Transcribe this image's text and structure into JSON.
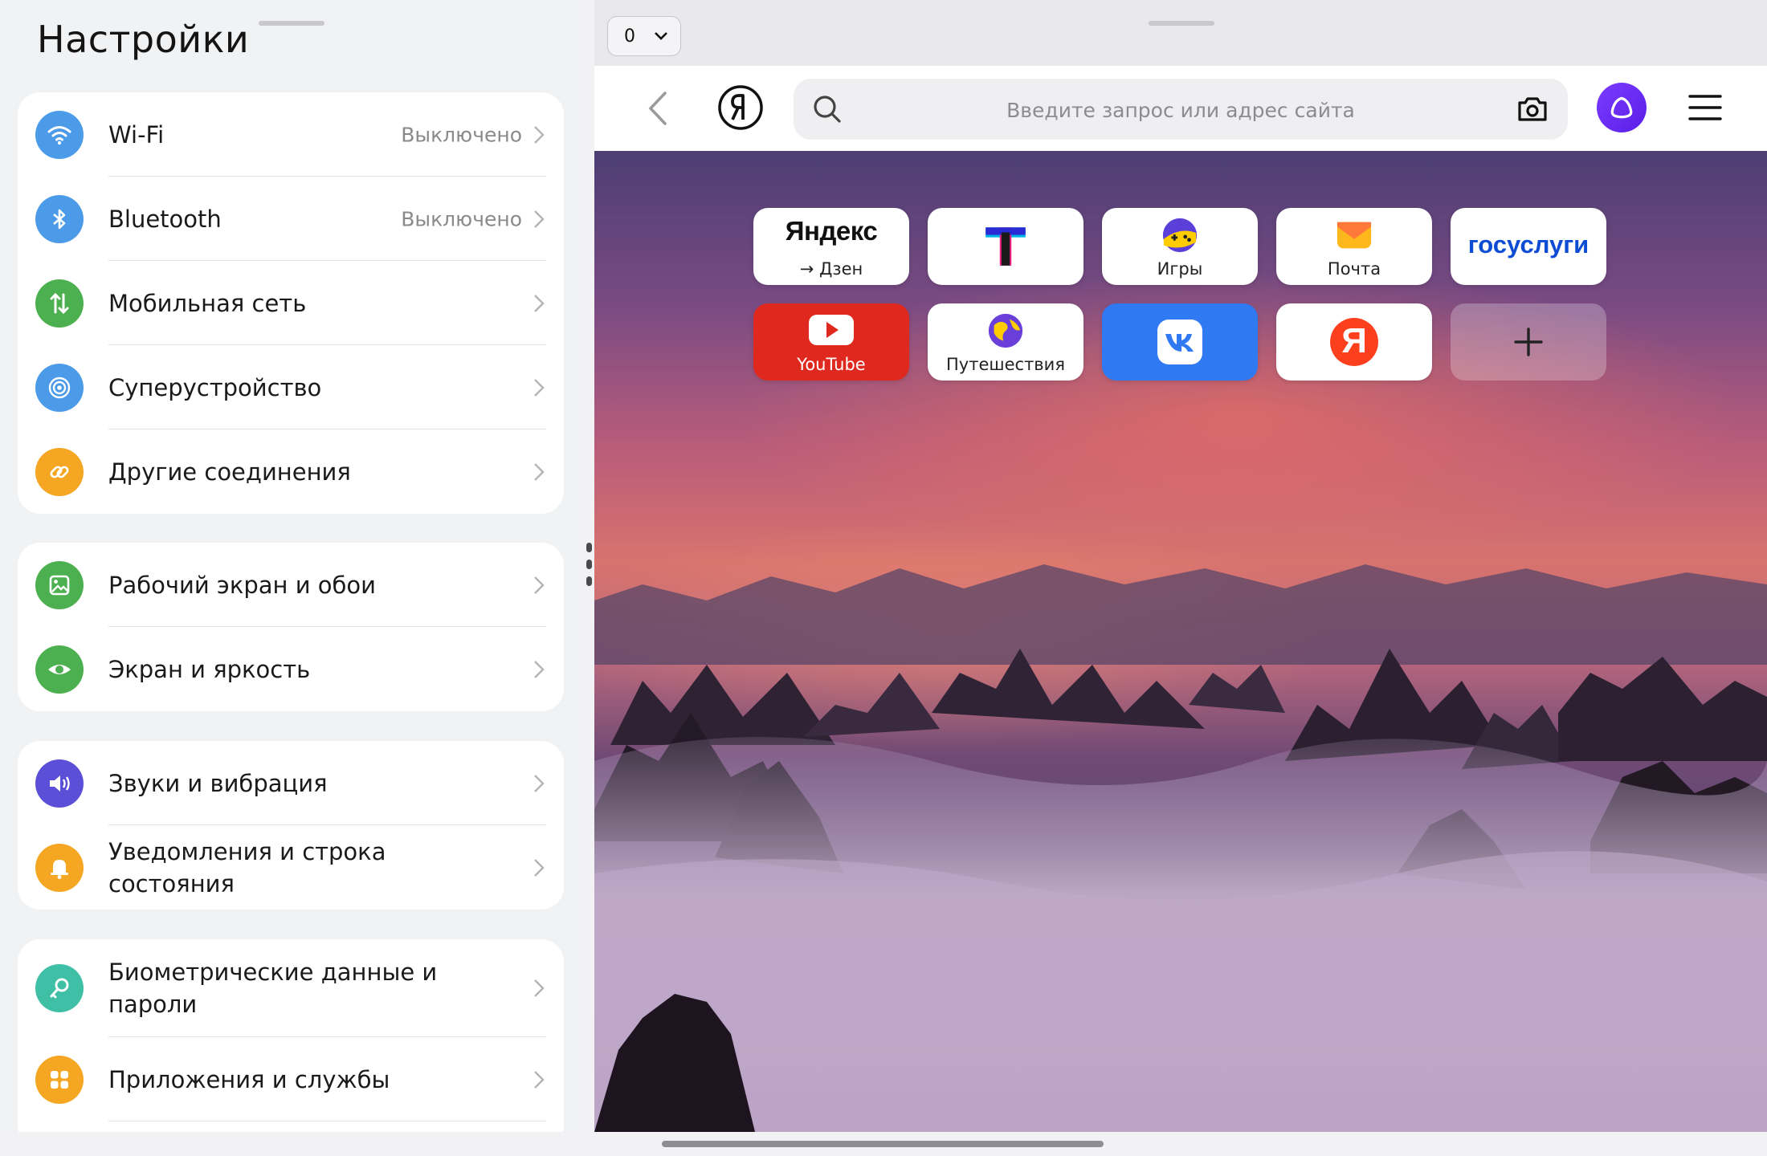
{
  "settings": {
    "title": "Настройки",
    "groups": [
      {
        "items": [
          {
            "label": "Wi-Fi",
            "value": "Выключено",
            "icon": "wifi-icon",
            "color": "#4c9be8"
          },
          {
            "label": "Bluetooth",
            "value": "Выключено",
            "icon": "bluetooth-icon",
            "color": "#4c9be8"
          },
          {
            "label": "Мобильная сеть",
            "value": "",
            "icon": "mobile-data-icon",
            "color": "#4caf50"
          },
          {
            "label": "Суперустройство",
            "value": "",
            "icon": "super-device-icon",
            "color": "#4c9be8"
          },
          {
            "label": "Другие соединения",
            "value": "",
            "icon": "link-icon",
            "color": "#f5a623"
          }
        ]
      },
      {
        "items": [
          {
            "label": "Рабочий экран и обои",
            "icon": "wallpaper-icon",
            "color": "#4caf50"
          },
          {
            "label": "Экран и яркость",
            "icon": "eye-icon",
            "color": "#4caf50"
          }
        ]
      },
      {
        "items": [
          {
            "label": "Звуки и вибрация",
            "icon": "speaker-icon",
            "color": "#5b4fd8"
          },
          {
            "label": "Уведомления и строка состояния",
            "icon": "bell-icon",
            "color": "#f5a623"
          }
        ]
      },
      {
        "items": [
          {
            "label": "Биометрические данные и пароли",
            "icon": "key-icon",
            "color": "#3fbfa6"
          },
          {
            "label": "Приложения и службы",
            "icon": "apps-icon",
            "color": "#f5a623"
          }
        ]
      }
    ]
  },
  "browser": {
    "tab_count": "0",
    "search_placeholder": "Введите запрос или адрес сайта",
    "alice_color": "#6a2cf5",
    "tiles": [
      {
        "label": "→ Дзен",
        "logo_text": "Яндекс"
      },
      {
        "label": "",
        "logo_text": "T"
      },
      {
        "label": "Игры"
      },
      {
        "label": "Почта"
      },
      {
        "label": "",
        "logo_text": "госуслуги"
      },
      {
        "label": "YouTube"
      },
      {
        "label": "Путешествия"
      },
      {
        "label": ""
      },
      {
        "label": "",
        "logo_text": "Я"
      },
      {
        "label": ""
      }
    ]
  }
}
